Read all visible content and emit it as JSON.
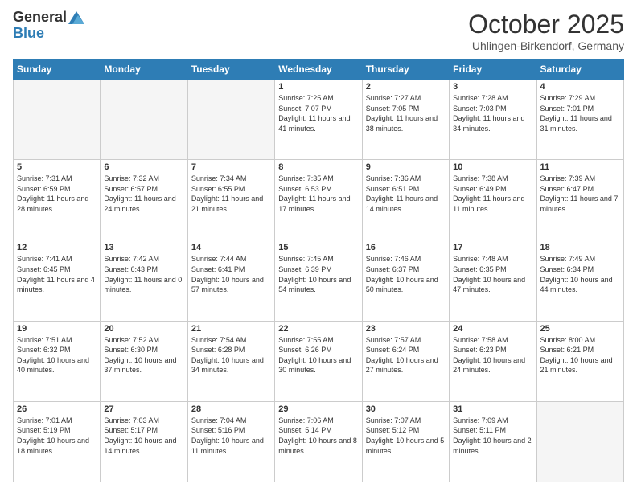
{
  "header": {
    "logo_general": "General",
    "logo_blue": "Blue",
    "month_title": "October 2025",
    "subtitle": "Uhlingen-Birkendorf, Germany"
  },
  "days_of_week": [
    "Sunday",
    "Monday",
    "Tuesday",
    "Wednesday",
    "Thursday",
    "Friday",
    "Saturday"
  ],
  "weeks": [
    [
      {
        "day": "",
        "info": ""
      },
      {
        "day": "",
        "info": ""
      },
      {
        "day": "",
        "info": ""
      },
      {
        "day": "1",
        "info": "Sunrise: 7:25 AM\nSunset: 7:07 PM\nDaylight: 11 hours\nand 41 minutes."
      },
      {
        "day": "2",
        "info": "Sunrise: 7:27 AM\nSunset: 7:05 PM\nDaylight: 11 hours\nand 38 minutes."
      },
      {
        "day": "3",
        "info": "Sunrise: 7:28 AM\nSunset: 7:03 PM\nDaylight: 11 hours\nand 34 minutes."
      },
      {
        "day": "4",
        "info": "Sunrise: 7:29 AM\nSunset: 7:01 PM\nDaylight: 11 hours\nand 31 minutes."
      }
    ],
    [
      {
        "day": "5",
        "info": "Sunrise: 7:31 AM\nSunset: 6:59 PM\nDaylight: 11 hours\nand 28 minutes."
      },
      {
        "day": "6",
        "info": "Sunrise: 7:32 AM\nSunset: 6:57 PM\nDaylight: 11 hours\nand 24 minutes."
      },
      {
        "day": "7",
        "info": "Sunrise: 7:34 AM\nSunset: 6:55 PM\nDaylight: 11 hours\nand 21 minutes."
      },
      {
        "day": "8",
        "info": "Sunrise: 7:35 AM\nSunset: 6:53 PM\nDaylight: 11 hours\nand 17 minutes."
      },
      {
        "day": "9",
        "info": "Sunrise: 7:36 AM\nSunset: 6:51 PM\nDaylight: 11 hours\nand 14 minutes."
      },
      {
        "day": "10",
        "info": "Sunrise: 7:38 AM\nSunset: 6:49 PM\nDaylight: 11 hours\nand 11 minutes."
      },
      {
        "day": "11",
        "info": "Sunrise: 7:39 AM\nSunset: 6:47 PM\nDaylight: 11 hours\nand 7 minutes."
      }
    ],
    [
      {
        "day": "12",
        "info": "Sunrise: 7:41 AM\nSunset: 6:45 PM\nDaylight: 11 hours\nand 4 minutes."
      },
      {
        "day": "13",
        "info": "Sunrise: 7:42 AM\nSunset: 6:43 PM\nDaylight: 11 hours\nand 0 minutes."
      },
      {
        "day": "14",
        "info": "Sunrise: 7:44 AM\nSunset: 6:41 PM\nDaylight: 10 hours\nand 57 minutes."
      },
      {
        "day": "15",
        "info": "Sunrise: 7:45 AM\nSunset: 6:39 PM\nDaylight: 10 hours\nand 54 minutes."
      },
      {
        "day": "16",
        "info": "Sunrise: 7:46 AM\nSunset: 6:37 PM\nDaylight: 10 hours\nand 50 minutes."
      },
      {
        "day": "17",
        "info": "Sunrise: 7:48 AM\nSunset: 6:35 PM\nDaylight: 10 hours\nand 47 minutes."
      },
      {
        "day": "18",
        "info": "Sunrise: 7:49 AM\nSunset: 6:34 PM\nDaylight: 10 hours\nand 44 minutes."
      }
    ],
    [
      {
        "day": "19",
        "info": "Sunrise: 7:51 AM\nSunset: 6:32 PM\nDaylight: 10 hours\nand 40 minutes."
      },
      {
        "day": "20",
        "info": "Sunrise: 7:52 AM\nSunset: 6:30 PM\nDaylight: 10 hours\nand 37 minutes."
      },
      {
        "day": "21",
        "info": "Sunrise: 7:54 AM\nSunset: 6:28 PM\nDaylight: 10 hours\nand 34 minutes."
      },
      {
        "day": "22",
        "info": "Sunrise: 7:55 AM\nSunset: 6:26 PM\nDaylight: 10 hours\nand 30 minutes."
      },
      {
        "day": "23",
        "info": "Sunrise: 7:57 AM\nSunset: 6:24 PM\nDaylight: 10 hours\nand 27 minutes."
      },
      {
        "day": "24",
        "info": "Sunrise: 7:58 AM\nSunset: 6:23 PM\nDaylight: 10 hours\nand 24 minutes."
      },
      {
        "day": "25",
        "info": "Sunrise: 8:00 AM\nSunset: 6:21 PM\nDaylight: 10 hours\nand 21 minutes."
      }
    ],
    [
      {
        "day": "26",
        "info": "Sunrise: 7:01 AM\nSunset: 5:19 PM\nDaylight: 10 hours\nand 18 minutes."
      },
      {
        "day": "27",
        "info": "Sunrise: 7:03 AM\nSunset: 5:17 PM\nDaylight: 10 hours\nand 14 minutes."
      },
      {
        "day": "28",
        "info": "Sunrise: 7:04 AM\nSunset: 5:16 PM\nDaylight: 10 hours\nand 11 minutes."
      },
      {
        "day": "29",
        "info": "Sunrise: 7:06 AM\nSunset: 5:14 PM\nDaylight: 10 hours\nand 8 minutes."
      },
      {
        "day": "30",
        "info": "Sunrise: 7:07 AM\nSunset: 5:12 PM\nDaylight: 10 hours\nand 5 minutes."
      },
      {
        "day": "31",
        "info": "Sunrise: 7:09 AM\nSunset: 5:11 PM\nDaylight: 10 hours\nand 2 minutes."
      },
      {
        "day": "",
        "info": ""
      }
    ]
  ]
}
